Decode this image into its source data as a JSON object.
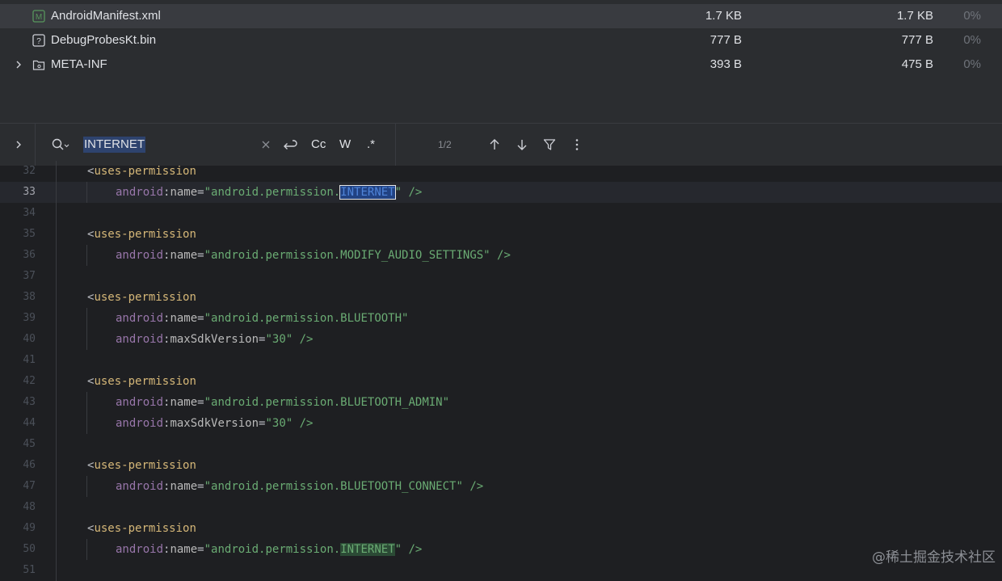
{
  "files": [
    {
      "name": "AndroidManifest.xml",
      "size": "1.7 KB",
      "compressed": "1.7 KB",
      "percent": "0%",
      "icon": "manifest-file-icon",
      "selected": true
    },
    {
      "name": "DebugProbesKt.bin",
      "size": "777 B",
      "compressed": "777 B",
      "percent": "0%",
      "icon": "unknown-file-icon",
      "selected": false
    },
    {
      "name": "META-INF",
      "size": "393 B",
      "compressed": "475 B",
      "percent": "0%",
      "icon": "folder-icon",
      "selected": false
    }
  ],
  "find": {
    "query": "INTERNET",
    "match_count": "1/2",
    "case_label": "Cc",
    "word_label": "W",
    "regex_label": ".*"
  },
  "editor": {
    "lines": [
      {
        "num": "32",
        "indent": 1,
        "tokens": [
          [
            "br",
            "<"
          ],
          [
            "tag",
            "uses-permission"
          ]
        ]
      },
      {
        "num": "33",
        "indent": 2,
        "current": true,
        "tokens": [
          [
            "ns",
            "android"
          ],
          [
            "br",
            ":"
          ],
          [
            "attr",
            "name"
          ],
          [
            "br",
            "="
          ],
          [
            "str",
            "\"android.permission."
          ],
          [
            "sel",
            "INTERNET"
          ],
          [
            "str",
            "\""
          ],
          [
            "close",
            " />"
          ]
        ]
      },
      {
        "num": "34",
        "indent": 0,
        "tokens": []
      },
      {
        "num": "35",
        "indent": 1,
        "tokens": [
          [
            "br",
            "<"
          ],
          [
            "tag",
            "uses-permission"
          ]
        ]
      },
      {
        "num": "36",
        "indent": 2,
        "tokens": [
          [
            "ns",
            "android"
          ],
          [
            "br",
            ":"
          ],
          [
            "attr",
            "name"
          ],
          [
            "br",
            "="
          ],
          [
            "str",
            "\"android.permission.MODIFY_AUDIO_SETTINGS\""
          ],
          [
            "close",
            " />"
          ]
        ]
      },
      {
        "num": "37",
        "indent": 0,
        "tokens": []
      },
      {
        "num": "38",
        "indent": 1,
        "tokens": [
          [
            "br",
            "<"
          ],
          [
            "tag",
            "uses-permission"
          ]
        ]
      },
      {
        "num": "39",
        "indent": 2,
        "tokens": [
          [
            "ns",
            "android"
          ],
          [
            "br",
            ":"
          ],
          [
            "attr",
            "name"
          ],
          [
            "br",
            "="
          ],
          [
            "str",
            "\"android.permission.BLUETOOTH\""
          ]
        ]
      },
      {
        "num": "40",
        "indent": 2,
        "tokens": [
          [
            "ns",
            "android"
          ],
          [
            "br",
            ":"
          ],
          [
            "attr",
            "maxSdkVersion"
          ],
          [
            "br",
            "="
          ],
          [
            "str",
            "\"30\""
          ],
          [
            "close",
            " />"
          ]
        ]
      },
      {
        "num": "41",
        "indent": 0,
        "tokens": []
      },
      {
        "num": "42",
        "indent": 1,
        "tokens": [
          [
            "br",
            "<"
          ],
          [
            "tag",
            "uses-permission"
          ]
        ]
      },
      {
        "num": "43",
        "indent": 2,
        "tokens": [
          [
            "ns",
            "android"
          ],
          [
            "br",
            ":"
          ],
          [
            "attr",
            "name"
          ],
          [
            "br",
            "="
          ],
          [
            "str",
            "\"android.permission.BLUETOOTH_ADMIN\""
          ]
        ]
      },
      {
        "num": "44",
        "indent": 2,
        "tokens": [
          [
            "ns",
            "android"
          ],
          [
            "br",
            ":"
          ],
          [
            "attr",
            "maxSdkVersion"
          ],
          [
            "br",
            "="
          ],
          [
            "str",
            "\"30\""
          ],
          [
            "close",
            " />"
          ]
        ]
      },
      {
        "num": "45",
        "indent": 0,
        "tokens": []
      },
      {
        "num": "46",
        "indent": 1,
        "tokens": [
          [
            "br",
            "<"
          ],
          [
            "tag",
            "uses-permission"
          ]
        ]
      },
      {
        "num": "47",
        "indent": 2,
        "tokens": [
          [
            "ns",
            "android"
          ],
          [
            "br",
            ":"
          ],
          [
            "attr",
            "name"
          ],
          [
            "br",
            "="
          ],
          [
            "str",
            "\"android.permission.BLUETOOTH_CONNECT\""
          ],
          [
            "close",
            " />"
          ]
        ]
      },
      {
        "num": "48",
        "indent": 0,
        "tokens": []
      },
      {
        "num": "49",
        "indent": 1,
        "tokens": [
          [
            "br",
            "<"
          ],
          [
            "tag",
            "uses-permission"
          ]
        ]
      },
      {
        "num": "50",
        "indent": 2,
        "tokens": [
          [
            "ns",
            "android"
          ],
          [
            "br",
            ":"
          ],
          [
            "attr",
            "name"
          ],
          [
            "br",
            "="
          ],
          [
            "str",
            "\"android.permission."
          ],
          [
            "match",
            "INTERNET"
          ],
          [
            "str",
            "\""
          ],
          [
            "close",
            " />"
          ]
        ]
      },
      {
        "num": "51",
        "indent": 0,
        "tokens": []
      }
    ]
  },
  "watermark": "@稀土掘金技术社区",
  "colors": {
    "background": "#1e1f22",
    "panel": "#2b2d30",
    "tag": "#d5b778",
    "namespace": "#9876aa",
    "string": "#6aab73",
    "selection": "#214283"
  }
}
